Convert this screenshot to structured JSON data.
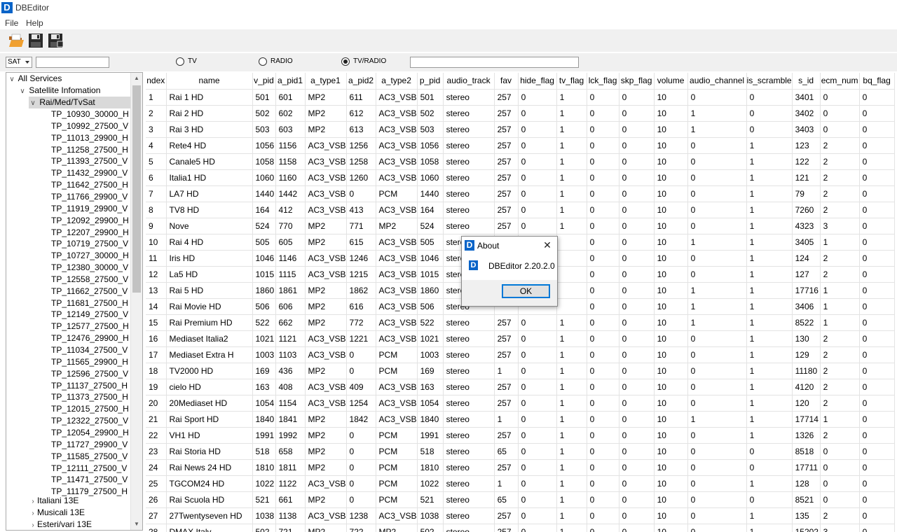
{
  "app": {
    "icon_letter": "D",
    "title": "DBEditor"
  },
  "menu": [
    "File",
    "Help"
  ],
  "toolbar": {
    "open_icon": "folder-open-icon",
    "save_icon": "floppy-save-icon",
    "save_as_icon": "floppy-save-all-icon"
  },
  "filter": {
    "sat_select": "SAT",
    "filter_value": "",
    "radios": [
      {
        "label": "TV",
        "checked": false
      },
      {
        "label": "RADIO",
        "checked": false
      },
      {
        "label": "TV/RADIO",
        "checked": true
      }
    ],
    "search_value": ""
  },
  "tree": {
    "root": "All Services",
    "sat_info": "Satellite Infomation",
    "selected_sat": "Rai/Med/TvSat",
    "transponders": [
      "TP_10930_30000_H",
      "TP_10992_27500_V",
      "TP_11013_29900_H",
      "TP_11258_27500_H",
      "TP_11393_27500_V",
      "TP_11432_29900_V",
      "TP_11642_27500_H",
      "TP_11766_29900_V",
      "TP_11919_29900_V",
      "TP_12092_29900_H",
      "TP_12207_29900_H",
      "TP_10719_27500_V",
      "TP_10727_30000_H",
      "TP_12380_30000_V",
      "TP_12558_27500_V",
      "TP_11662_27500_V",
      "TP_11681_27500_H",
      "TP_12149_27500_V",
      "TP_12577_27500_H",
      "TP_12476_29900_H",
      "TP_11034_27500_V",
      "TP_11565_29900_H",
      "TP_12596_27500_V",
      "TP_11137_27500_H",
      "TP_11373_27500_H",
      "TP_12015_27500_H",
      "TP_12322_27500_V",
      "TP_12054_29900_H",
      "TP_11727_29900_V",
      "TP_11585_27500_V",
      "TP_12111_27500_V",
      "TP_11471_27500_V",
      "TP_11179_27500_H"
    ],
    "other_sats": [
      "Italiani 13E",
      "Musicali 13E",
      "Esteri/vari 13E"
    ]
  },
  "grid": {
    "columns": [
      "ndex",
      "name",
      "v_pid",
      "a_pid1",
      "a_type1",
      "a_pid2",
      "a_type2",
      "p_pid",
      "audio_track",
      "fav",
      "hide_flag",
      "tv_flag",
      "lck_flag",
      "skp_flag",
      "volume",
      "audio_channel",
      "is_scramble",
      "s_id",
      "ecm_num",
      "bq_flag"
    ],
    "rows": [
      [
        "1",
        "Rai 1 HD",
        "501",
        "601",
        "MP2",
        "611",
        "AC3_VSB",
        "501",
        "stereo",
        "257",
        "0",
        "1",
        "0",
        "0",
        "10",
        "0",
        "0",
        "3401",
        "0",
        "0"
      ],
      [
        "2",
        "Rai 2 HD",
        "502",
        "602",
        "MP2",
        "612",
        "AC3_VSB",
        "502",
        "stereo",
        "257",
        "0",
        "1",
        "0",
        "0",
        "10",
        "1",
        "0",
        "3402",
        "0",
        "0"
      ],
      [
        "3",
        "Rai 3 HD",
        "503",
        "603",
        "MP2",
        "613",
        "AC3_VSB",
        "503",
        "stereo",
        "257",
        "0",
        "1",
        "0",
        "0",
        "10",
        "1",
        "0",
        "3403",
        "0",
        "0"
      ],
      [
        "4",
        "Rete4 HD",
        "1056",
        "1156",
        "AC3_VSB",
        "1256",
        "AC3_VSB",
        "1056",
        "stereo",
        "257",
        "0",
        "1",
        "0",
        "0",
        "10",
        "0",
        "1",
        "123",
        "2",
        "0"
      ],
      [
        "5",
        "Canale5 HD",
        "1058",
        "1158",
        "AC3_VSB",
        "1258",
        "AC3_VSB",
        "1058",
        "stereo",
        "257",
        "0",
        "1",
        "0",
        "0",
        "10",
        "0",
        "1",
        "122",
        "2",
        "0"
      ],
      [
        "6",
        "Italia1 HD",
        "1060",
        "1160",
        "AC3_VSB",
        "1260",
        "AC3_VSB",
        "1060",
        "stereo",
        "257",
        "0",
        "1",
        "0",
        "0",
        "10",
        "0",
        "1",
        "121",
        "2",
        "0"
      ],
      [
        "7",
        "LA7 HD",
        "1440",
        "1442",
        "AC3_VSB",
        "0",
        "PCM",
        "1440",
        "stereo",
        "257",
        "0",
        "1",
        "0",
        "0",
        "10",
        "0",
        "1",
        "79",
        "2",
        "0"
      ],
      [
        "8",
        "TV8 HD",
        "164",
        "412",
        "AC3_VSB",
        "413",
        "AC3_VSB",
        "164",
        "stereo",
        "257",
        "0",
        "1",
        "0",
        "0",
        "10",
        "0",
        "1",
        "7260",
        "2",
        "0"
      ],
      [
        "9",
        "Nove",
        "524",
        "770",
        "MP2",
        "771",
        "MP2",
        "524",
        "stereo",
        "257",
        "0",
        "1",
        "0",
        "0",
        "10",
        "0",
        "1",
        "4323",
        "3",
        "0"
      ],
      [
        "10",
        "Rai 4 HD",
        "505",
        "605",
        "MP2",
        "615",
        "AC3_VSB",
        "505",
        "stereo",
        "",
        "",
        "",
        "0",
        "0",
        "10",
        "1",
        "1",
        "3405",
        "1",
        "0"
      ],
      [
        "11",
        "Iris HD",
        "1046",
        "1146",
        "AC3_VSB",
        "1246",
        "AC3_VSB",
        "1046",
        "stereo",
        "",
        "",
        "",
        "0",
        "0",
        "10",
        "0",
        "1",
        "124",
        "2",
        "0"
      ],
      [
        "12",
        "La5 HD",
        "1015",
        "1115",
        "AC3_VSB",
        "1215",
        "AC3_VSB",
        "1015",
        "stereo",
        "",
        "",
        "",
        "0",
        "0",
        "10",
        "0",
        "1",
        "127",
        "2",
        "0"
      ],
      [
        "13",
        "Rai 5 HD",
        "1860",
        "1861",
        "MP2",
        "1862",
        "AC3_VSB",
        "1860",
        "stereo",
        "",
        "",
        "",
        "0",
        "0",
        "10",
        "1",
        "1",
        "17716",
        "1",
        "0"
      ],
      [
        "14",
        "Rai Movie HD",
        "506",
        "606",
        "MP2",
        "616",
        "AC3_VSB",
        "506",
        "stereo",
        "",
        "",
        "",
        "0",
        "0",
        "10",
        "1",
        "1",
        "3406",
        "1",
        "0"
      ],
      [
        "15",
        "Rai Premium HD",
        "522",
        "662",
        "MP2",
        "772",
        "AC3_VSB",
        "522",
        "stereo",
        "257",
        "0",
        "1",
        "0",
        "0",
        "10",
        "1",
        "1",
        "8522",
        "1",
        "0"
      ],
      [
        "16",
        "Mediaset Italia2",
        "1021",
        "1121",
        "AC3_VSB",
        "1221",
        "AC3_VSB",
        "1021",
        "stereo",
        "257",
        "0",
        "1",
        "0",
        "0",
        "10",
        "0",
        "1",
        "130",
        "2",
        "0"
      ],
      [
        "17",
        "Mediaset Extra H",
        "1003",
        "1103",
        "AC3_VSB",
        "0",
        "PCM",
        "1003",
        "stereo",
        "257",
        "0",
        "1",
        "0",
        "0",
        "10",
        "0",
        "1",
        "129",
        "2",
        "0"
      ],
      [
        "18",
        "TV2000 HD",
        "169",
        "436",
        "MP2",
        "0",
        "PCM",
        "169",
        "stereo",
        "1",
        "0",
        "1",
        "0",
        "0",
        "10",
        "0",
        "1",
        "11180",
        "2",
        "0"
      ],
      [
        "19",
        "cielo HD",
        "163",
        "408",
        "AC3_VSB",
        "409",
        "AC3_VSB",
        "163",
        "stereo",
        "257",
        "0",
        "1",
        "0",
        "0",
        "10",
        "0",
        "1",
        "4120",
        "2",
        "0"
      ],
      [
        "20",
        "20Mediaset HD",
        "1054",
        "1154",
        "AC3_VSB",
        "1254",
        "AC3_VSB",
        "1054",
        "stereo",
        "257",
        "0",
        "1",
        "0",
        "0",
        "10",
        "0",
        "1",
        "120",
        "2",
        "0"
      ],
      [
        "21",
        "Rai Sport   HD",
        "1840",
        "1841",
        "MP2",
        "1842",
        "AC3_VSB",
        "1840",
        "stereo",
        "1",
        "0",
        "1",
        "0",
        "0",
        "10",
        "1",
        "1",
        "17714",
        "1",
        "0"
      ],
      [
        "22",
        "VH1 HD",
        "1991",
        "1992",
        "MP2",
        "0",
        "PCM",
        "1991",
        "stereo",
        "257",
        "0",
        "1",
        "0",
        "0",
        "10",
        "0",
        "1",
        "1326",
        "2",
        "0"
      ],
      [
        "23",
        "Rai Storia HD",
        "518",
        "658",
        "MP2",
        "0",
        "PCM",
        "518",
        "stereo",
        "65",
        "0",
        "1",
        "0",
        "0",
        "10",
        "0",
        "0",
        "8518",
        "0",
        "0"
      ],
      [
        "24",
        "Rai News 24 HD",
        "1810",
        "1811",
        "MP2",
        "0",
        "PCM",
        "1810",
        "stereo",
        "257",
        "0",
        "1",
        "0",
        "0",
        "10",
        "0",
        "0",
        "17711",
        "0",
        "0"
      ],
      [
        "25",
        "TGCOM24 HD",
        "1022",
        "1122",
        "AC3_VSB",
        "0",
        "PCM",
        "1022",
        "stereo",
        "1",
        "0",
        "1",
        "0",
        "0",
        "10",
        "0",
        "1",
        "128",
        "0",
        "0"
      ],
      [
        "26",
        "Rai Scuola HD",
        "521",
        "661",
        "MP2",
        "0",
        "PCM",
        "521",
        "stereo",
        "65",
        "0",
        "1",
        "0",
        "0",
        "10",
        "0",
        "0",
        "8521",
        "0",
        "0"
      ],
      [
        "27",
        "27Twentyseven HD",
        "1038",
        "1138",
        "AC3_VSB",
        "1238",
        "AC3_VSB",
        "1038",
        "stereo",
        "257",
        "0",
        "1",
        "0",
        "0",
        "10",
        "0",
        "1",
        "135",
        "2",
        "0"
      ],
      [
        "28",
        "DMAX Italy",
        "502",
        "721",
        "MP2",
        "722",
        "MP2",
        "502",
        "stereo",
        "257",
        "0",
        "1",
        "0",
        "0",
        "10",
        "0",
        "1",
        "15202",
        "3",
        "0"
      ]
    ]
  },
  "about_dialog": {
    "title": "About",
    "close": "✕",
    "text": "DBEditor 2.20.2.0",
    "ok_label": "OK"
  },
  "colors": {
    "accent": "#0078d7",
    "app_icon": "#0a64c8"
  }
}
